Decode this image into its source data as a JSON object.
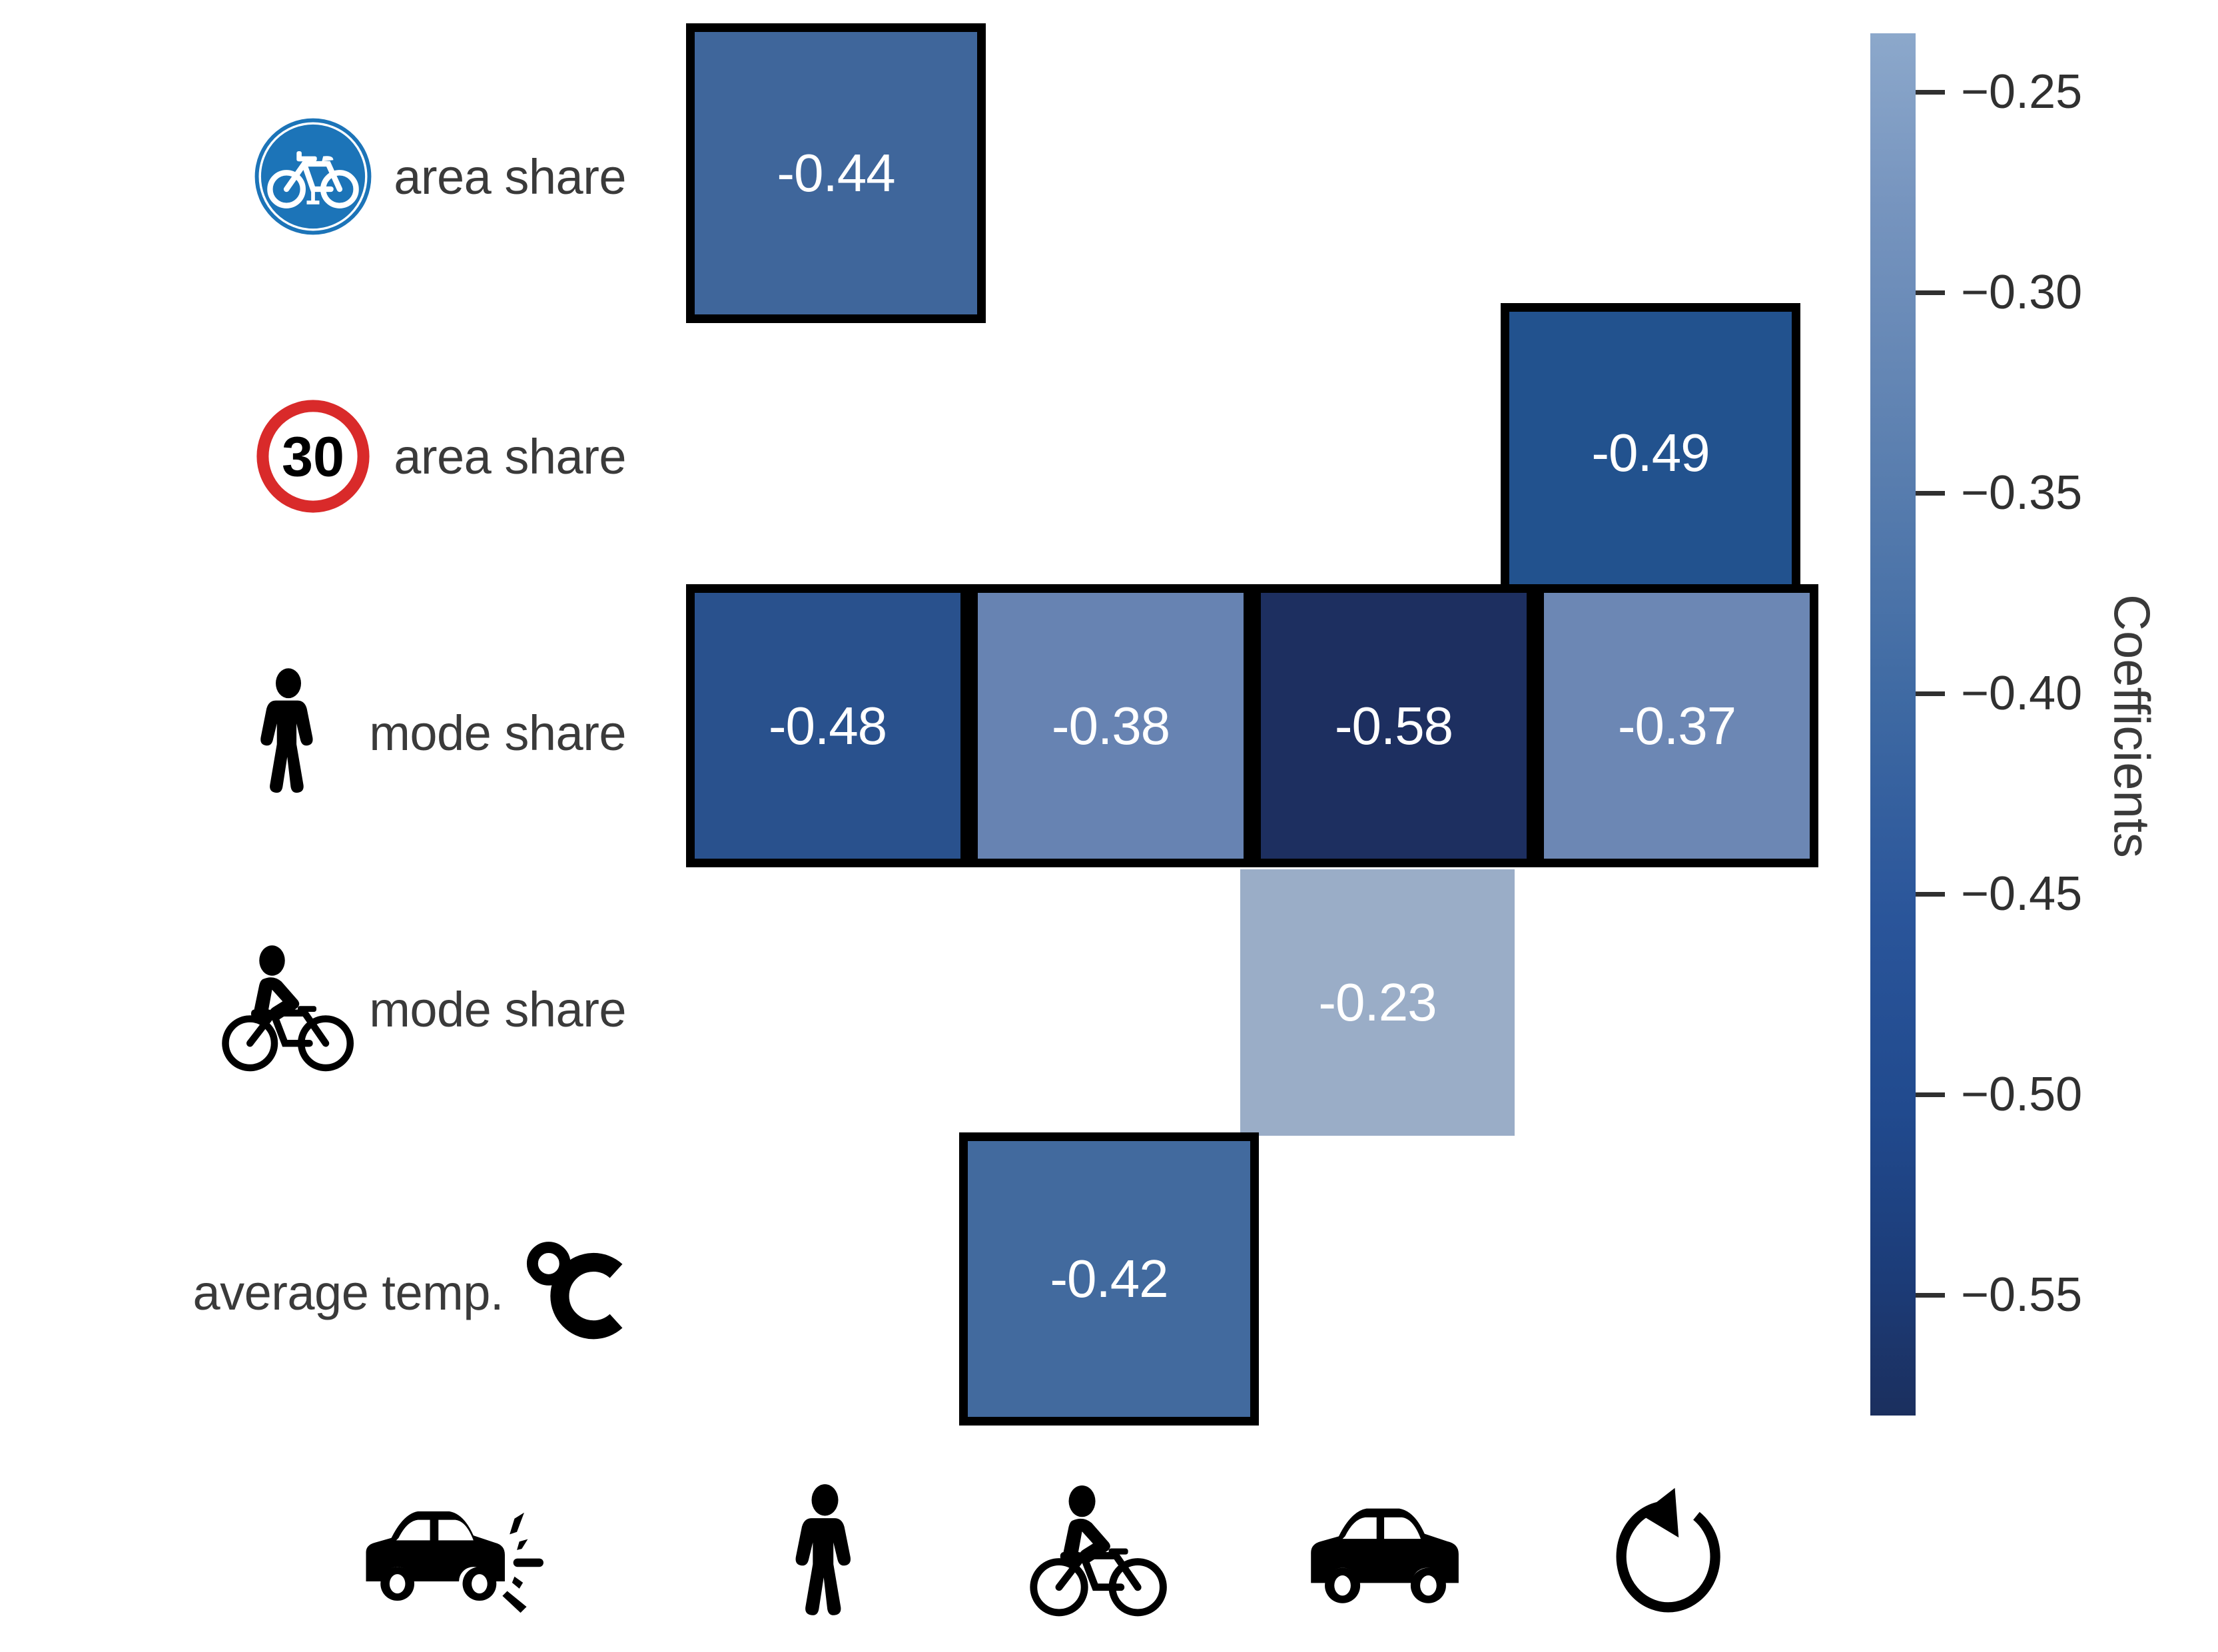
{
  "chart_data": {
    "type": "heatmap",
    "title": "",
    "colorbar_label": "Coefficients",
    "row_labels": [
      {
        "icon": "bicycle-route-sign-icon",
        "text": "area share"
      },
      {
        "icon": "speed-limit-30-sign-icon",
        "text": "area share"
      },
      {
        "icon": "pedestrian-icon",
        "text": "mode share"
      },
      {
        "icon": "cyclist-icon",
        "text": "mode share"
      },
      {
        "icon": "degree-celsius-icon",
        "text": "average temp."
      }
    ],
    "column_icons": [
      "car-crash-icon",
      "pedestrian-icon",
      "cyclist-icon",
      "car-icon",
      "rotation-arrow-icon"
    ],
    "columns": [
      "crash",
      "pedestrian",
      "cyclist",
      "car",
      "rotation"
    ],
    "rows": [
      "bicycle area share",
      "30 zone area share",
      "pedestrian mode share",
      "cyclist mode share",
      "average temp."
    ],
    "cells": [
      {
        "row": 0,
        "col": 0,
        "value": "-0.44",
        "color": "#3f669b",
        "significant": true
      },
      {
        "row": 1,
        "col": 3,
        "value": "-0.49",
        "color": "#22528e",
        "significant": true
      },
      {
        "row": 2,
        "col": 0,
        "value": "-0.48",
        "color": "#29518d",
        "significant": true
      },
      {
        "row": 2,
        "col": 1,
        "value": "-0.38",
        "color": "#6783b2",
        "significant": true
      },
      {
        "row": 2,
        "col": 2,
        "value": "-0.58",
        "color": "#1d2f60",
        "significant": true
      },
      {
        "row": 2,
        "col": 3,
        "value": "-0.37",
        "color": "#6c87b4",
        "significant": true
      },
      {
        "row": 3,
        "col": 2,
        "value": "-0.23",
        "color": "#9aadc7",
        "significant": false
      },
      {
        "row": 4,
        "col": 1,
        "value": "-0.42",
        "color": "#426a9e",
        "significant": true
      }
    ],
    "colorbar": {
      "ticks": [
        "−0.25",
        "−0.30",
        "−0.35",
        "−0.40",
        "−0.45",
        "−0.50",
        "−0.55"
      ],
      "tick_values": [
        -0.25,
        -0.3,
        -0.35,
        -0.4,
        -0.45,
        -0.5,
        -0.55
      ],
      "vmin": -0.58,
      "vmax": -0.23,
      "orientation": "vertical",
      "position": "right",
      "colormap": "Blues (reversed, dark = more negative)"
    },
    "colors": {
      "border": "#000000",
      "text_on_cell": "#ffffff",
      "label_text": "#3a3a3a",
      "sign_blue": "#1c74b8",
      "sign_red": "#d92a2a",
      "background": "#ffffff"
    },
    "notes": "Black outline indicates statistically significant coefficient; the -0.23 cell is unbordered."
  }
}
